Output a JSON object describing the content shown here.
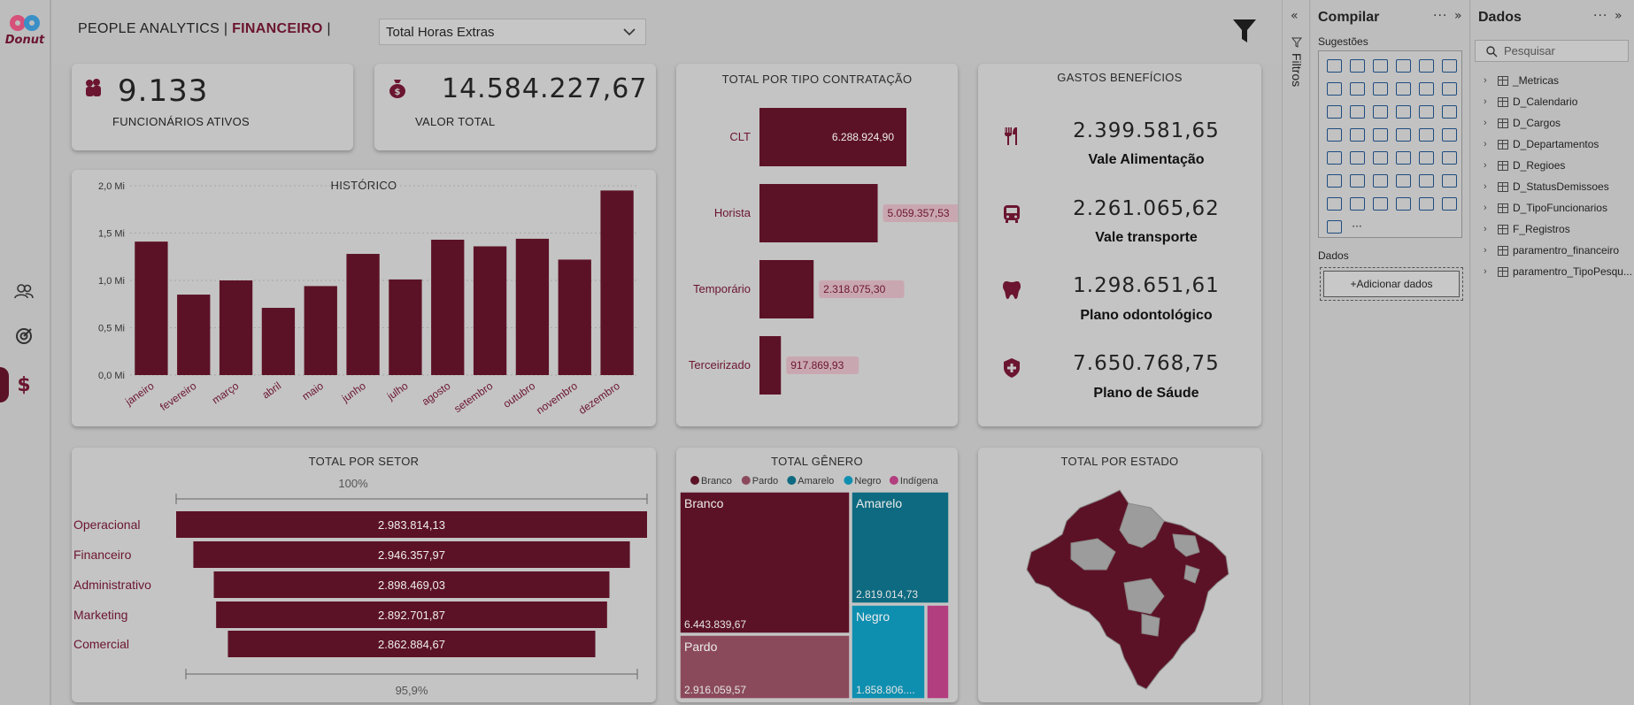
{
  "header": {
    "title_prefix": "PEOPLE ANALYTICS | ",
    "title_highlight": "FINANCEIRO",
    "title_suffix": " |",
    "dropdown_value": "Total Horas Extras"
  },
  "kpis": [
    {
      "value": "9.133",
      "label": "FUNCIONÁRIOS ATIVOS",
      "icon": "people-icon"
    },
    {
      "value": "14.584.227,67",
      "label": "VALOR TOTAL",
      "icon": "money-bag-icon"
    }
  ],
  "historico": {
    "title": "HISTÓRICO",
    "chart_data": {
      "type": "bar",
      "title": "HISTÓRICO",
      "categories": [
        "janeiro",
        "fevereiro",
        "março",
        "abril",
        "maio",
        "junho",
        "julho",
        "agosto",
        "setembro",
        "outubro",
        "novembro",
        "dezembro"
      ],
      "values": [
        1.41,
        0.85,
        1.0,
        0.71,
        0.94,
        1.28,
        1.01,
        1.43,
        1.36,
        1.44,
        1.22,
        1.95
      ],
      "yticks": [
        "0,0 Mi",
        "0,5 Mi",
        "1,0 Mi",
        "1,5 Mi",
        "2,0 Mi"
      ],
      "ylim": [
        0,
        2.0
      ],
      "unit": "Mi",
      "color": "#5c1226"
    }
  },
  "contratacao": {
    "title": "TOTAL POR TIPO CONTRATAÇÃO",
    "chart_data": {
      "type": "bar",
      "orientation": "horizontal",
      "title": "TOTAL POR TIPO CONTRATAÇÃO",
      "categories": [
        "CLT",
        "Horista",
        "Temporário",
        "Terceirizado"
      ],
      "values": [
        6288924.9,
        5059357.53,
        2318075.3,
        917869.93
      ],
      "labels": [
        "6.288.924,90",
        "5.059.357,53",
        "2.318.075,30",
        "917.869,93"
      ],
      "color": "#5c1226"
    }
  },
  "beneficios": {
    "title": "GASTOS BENEFÍCIOS",
    "items": [
      {
        "value": "2.399.581,65",
        "label": "Vale Alimentação",
        "icon": "fork-knife-icon"
      },
      {
        "value": "2.261.065,62",
        "label": "Vale transporte",
        "icon": "bus-icon"
      },
      {
        "value": "1.298.651,61",
        "label": "Plano odontológico",
        "icon": "tooth-icon"
      },
      {
        "value": "7.650.768,75",
        "label": "Plano de Sáude",
        "icon": "shield-cross-icon"
      }
    ]
  },
  "setor": {
    "title": "TOTAL POR SETOR",
    "top_pct": "100%",
    "bottom_pct": "95,9%",
    "chart_data": {
      "type": "bar",
      "orientation": "funnel",
      "title": "TOTAL POR SETOR",
      "categories": [
        "Operacional",
        "Financeiro",
        "Administrativo",
        "Marketing",
        "Comercial"
      ],
      "values": [
        2983814.13,
        2946357.97,
        2898469.03,
        2892701.87,
        2862884.67
      ],
      "labels": [
        "2.983.814,13",
        "2.946.357,97",
        "2.898.469,03",
        "2.892.701,87",
        "2.862.884,67"
      ],
      "color": "#5c1226"
    }
  },
  "genero": {
    "title": "TOTAL GÊNERO",
    "chart_data": {
      "type": "treemap",
      "title": "TOTAL GÊNERO",
      "legend": [
        {
          "name": "Branco",
          "color": "#5c1226"
        },
        {
          "name": "Pardo",
          "color": "#8b4a5c"
        },
        {
          "name": "Amarelo",
          "color": "#0e6a80"
        },
        {
          "name": "Negro",
          "color": "#0f8fb0"
        },
        {
          "name": "Indígena",
          "color": "#b23d7f"
        }
      ],
      "values": [
        6443839.67,
        2916059.57,
        2819014.73,
        1858806,
        400000
      ],
      "labels": [
        "6.443.839,67",
        "2.916.059,57",
        "2.819.014,73",
        "1.858.806....",
        ""
      ]
    }
  },
  "estado": {
    "title": "TOTAL POR ESTADO"
  },
  "panes": {
    "filters_label": "Filtros",
    "build_title": "Compilar",
    "build_sub": "Sugestões",
    "dados_label": "Dados",
    "add_data": "+Adicionar dados",
    "data_title": "Dados",
    "search_placeholder": "Pesquisar",
    "tables": [
      "_Metricas",
      "D_Calendario",
      "D_Cargos",
      "D_Departamentos",
      "D_Regioes",
      "D_StatusDemissoes",
      "D_TipoFuncionarios",
      "F_Registros",
      "paramentro_financeiro",
      "paramentro_TipoPesqu..."
    ]
  }
}
